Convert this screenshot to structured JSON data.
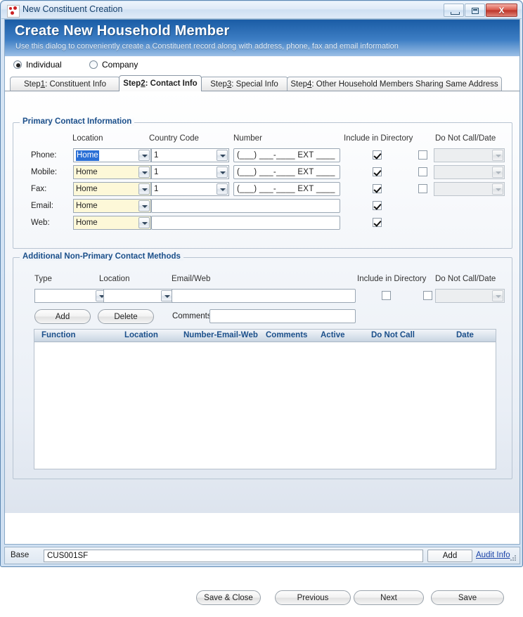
{
  "window": {
    "title": "New Constituent Creation",
    "icon": "app-icon",
    "controls": {
      "minimize": "minimize",
      "maximize": "maximize",
      "close": "X"
    }
  },
  "banner": {
    "heading": "Create New Household Member",
    "subtitle": "Use this dialog to conveniently create a Constituent record along with address, phone, fax and email information"
  },
  "entity_type": {
    "options": [
      {
        "label": "Individual",
        "selected": true
      },
      {
        "label": "Company",
        "selected": false
      }
    ]
  },
  "tabs": [
    {
      "prefix": "Step ",
      "mnemonic": "1",
      "suffix": ": Constituent Info",
      "active": false
    },
    {
      "prefix": "Step ",
      "mnemonic": "2",
      "suffix": ": Contact Info",
      "active": true
    },
    {
      "prefix": "Step ",
      "mnemonic": "3",
      "suffix": ": Special Info",
      "active": false
    },
    {
      "prefix": "Step ",
      "mnemonic": "4",
      "suffix": ": Other Household Members Sharing Same Address",
      "active": false
    }
  ],
  "primary_contact": {
    "group_label": "Primary Contact Information",
    "columns": {
      "location": "Location",
      "country_code": "Country Code",
      "number": "Number",
      "include_in_directory": "Include in Directory",
      "do_not_call_date": "Do Not Call/Date"
    },
    "rows": [
      {
        "label": "Phone:",
        "location": "Home",
        "location_selected": true,
        "country_code": "1",
        "number": "(___) ___-____ EXT ____",
        "include_in_directory": true,
        "do_not_call": false,
        "date": ""
      },
      {
        "label": "Mobile:",
        "location": "Home",
        "location_selected": false,
        "country_code": "1",
        "number": "(___) ___-____ EXT ____",
        "include_in_directory": true,
        "do_not_call": false,
        "date": ""
      },
      {
        "label": "Fax:",
        "location": "Home",
        "location_selected": false,
        "country_code": "1",
        "number": "(___) ___-____ EXT ____",
        "include_in_directory": true,
        "do_not_call": false,
        "date": ""
      },
      {
        "label": "Email:",
        "location": "Home",
        "location_selected": false,
        "country_code": "",
        "number": "",
        "include_in_directory": true,
        "do_not_call": null,
        "date": null
      },
      {
        "label": "Web:",
        "location": "Home",
        "location_selected": false,
        "country_code": "",
        "number": "",
        "include_in_directory": true,
        "do_not_call": null,
        "date": null
      }
    ]
  },
  "additional_contact": {
    "group_label": "Additional Non-Primary Contact Methods",
    "columns": {
      "type": "Type",
      "location": "Location",
      "email_web": "Email/Web",
      "include_in_directory": "Include in Directory",
      "do_not_call_date": "Do Not Call/Date"
    },
    "values": {
      "type": "",
      "location": "",
      "email_web": "",
      "include_in_directory": false,
      "do_not_call": false,
      "date": ""
    },
    "add_label": "Add",
    "delete_label": "Delete",
    "comments_label": "Comments",
    "comments_value": "",
    "grid": {
      "headers": [
        "Function",
        "Location",
        "Number-Email-Web",
        "Comments",
        "Active",
        "Do Not Call",
        "Date"
      ],
      "rows": []
    }
  },
  "footer": {
    "buttons": [
      "Save & Close",
      "Previous",
      "Next",
      "Save"
    ]
  },
  "statusbar": {
    "label": "Base",
    "value": "CUS001SF",
    "add_label": "Add",
    "audit_label": "Audit Info"
  },
  "colors": {
    "banner_top": "#1a5ca5",
    "banner_bottom": "#9dc0e6",
    "group_label": "#1b4f8a",
    "yellow_field": "#fdf8d8",
    "selection": "#2a6fd6",
    "link": "#1a43a8"
  }
}
